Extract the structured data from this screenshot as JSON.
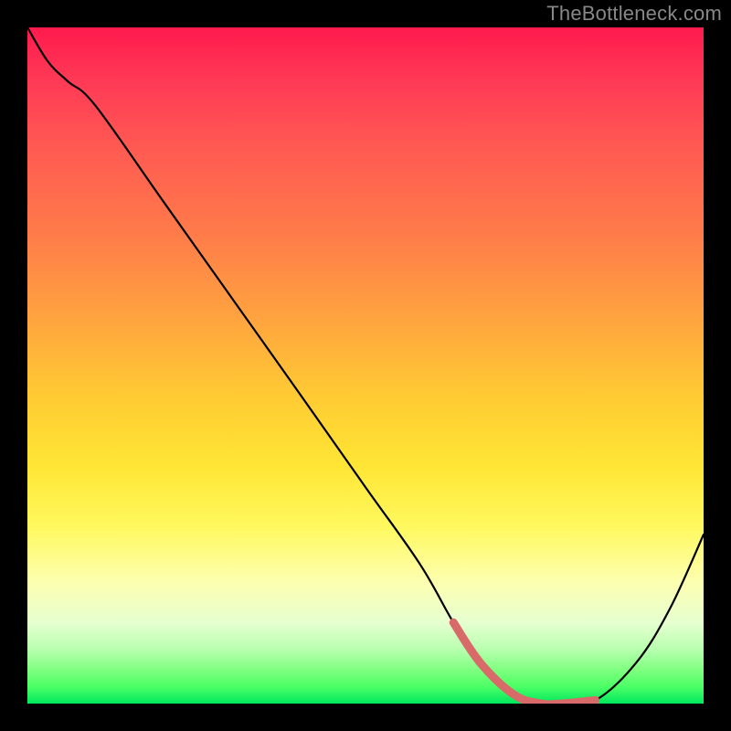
{
  "watermark": "TheBottleneck.com",
  "chart_data": {
    "type": "line",
    "title": "",
    "xlabel": "",
    "ylabel": "",
    "xlim": [
      0,
      100
    ],
    "ylim": [
      0,
      100
    ],
    "grid": false,
    "series": [
      {
        "name": "curve",
        "x": [
          0,
          3,
          6,
          10,
          20,
          30,
          40,
          50,
          58,
          63,
          67,
          72,
          76,
          79,
          84,
          90,
          95,
          100
        ],
        "y": [
          100,
          95,
          92,
          88.5,
          74.4,
          60.3,
          46.2,
          32,
          20.7,
          12,
          6,
          1.3,
          0,
          0,
          0.5,
          6,
          14,
          25
        ]
      },
      {
        "name": "highlight",
        "x": [
          63,
          67,
          72,
          76,
          79,
          84
        ],
        "y": [
          12,
          6,
          1.3,
          0,
          0,
          0.5
        ]
      }
    ],
    "colors": {
      "curve": "#000000",
      "highlight": "#d86a6a"
    }
  }
}
